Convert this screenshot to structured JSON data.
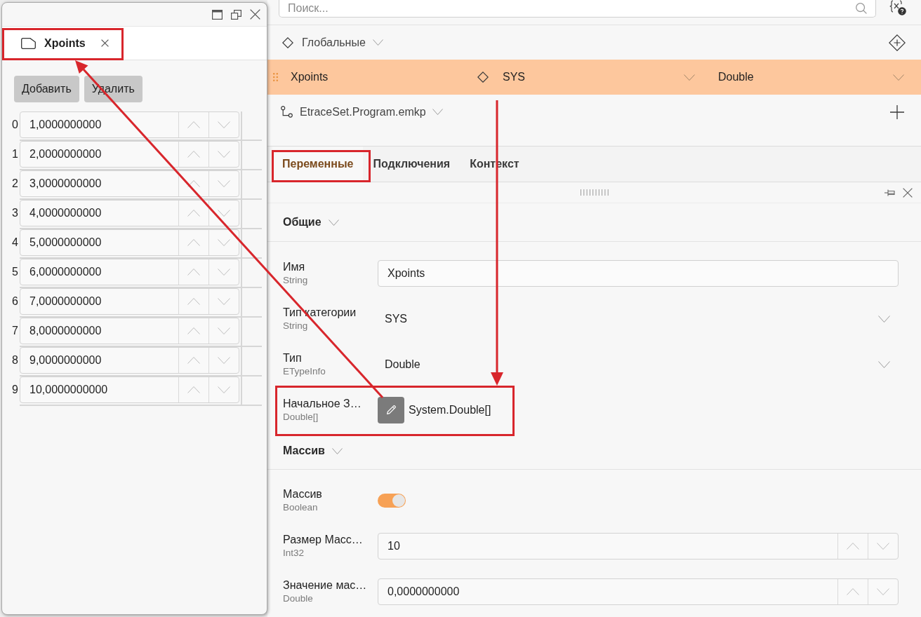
{
  "floating_window": {
    "tab": {
      "label": "Xpoints"
    },
    "buttons": [
      "Добавить",
      "Удалить"
    ],
    "rows": [
      {
        "index": "0",
        "value": "1,0000000000"
      },
      {
        "index": "1",
        "value": "2,0000000000"
      },
      {
        "index": "2",
        "value": "3,0000000000"
      },
      {
        "index": "3",
        "value": "4,0000000000"
      },
      {
        "index": "4",
        "value": "5,0000000000"
      },
      {
        "index": "5",
        "value": "6,0000000000"
      },
      {
        "index": "6",
        "value": "7,0000000000"
      },
      {
        "index": "7",
        "value": "8,0000000000"
      },
      {
        "index": "8",
        "value": "9,0000000000"
      },
      {
        "index": "9",
        "value": "10,0000000000"
      }
    ]
  },
  "search": {
    "placeholder": "Поиск..."
  },
  "tree": {
    "group": {
      "label": "Глобальные"
    },
    "variable_row": {
      "name": "Xpoints",
      "category": "SYS",
      "type": "Double",
      "selected": true
    },
    "program": {
      "label": "EtraceSet.Program.emkp"
    }
  },
  "tabs": [
    {
      "label": "Переменные",
      "selected": true
    },
    {
      "label": "Подключения",
      "selected": false
    },
    {
      "label": "Контекст",
      "selected": false
    }
  ],
  "sections": [
    {
      "title": "Общие",
      "properties": [
        {
          "kind": "text",
          "label": "Имя",
          "type": "String",
          "value": "Xpoints"
        },
        {
          "kind": "select",
          "label": "Тип категории",
          "type": "String",
          "value": "SYS"
        },
        {
          "kind": "select",
          "label": "Тип",
          "type": "ETypeInfo",
          "value": "Double"
        },
        {
          "kind": "editor",
          "label": "Начальное З…",
          "type": "Double[]",
          "value": "System.Double[]"
        }
      ]
    },
    {
      "title": "Массив",
      "properties": [
        {
          "kind": "toggle",
          "label": "Массив",
          "type": "Boolean",
          "on": true
        },
        {
          "kind": "number",
          "label": "Размер Масс…",
          "type": "Int32",
          "value": "10"
        },
        {
          "kind": "number",
          "label": "Значение мас…",
          "type": "Double",
          "value": "0,0000000000"
        }
      ]
    }
  ]
}
